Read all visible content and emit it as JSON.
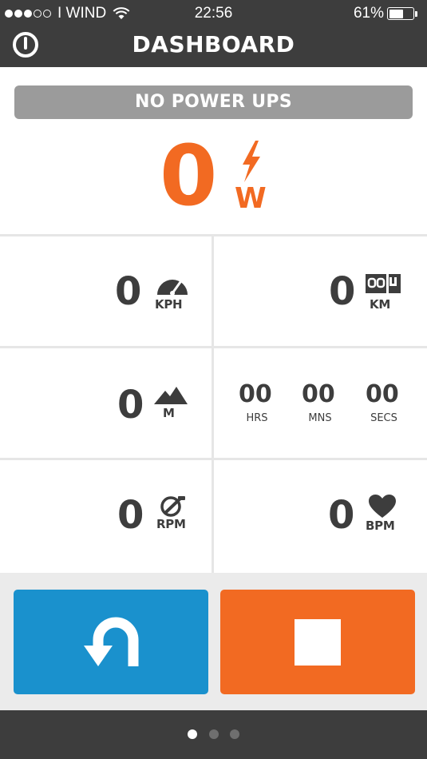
{
  "status_bar": {
    "carrier": "I WIND",
    "time": "22:56",
    "battery": "61%",
    "battery_level": 0.61,
    "signal_bars_filled": 3,
    "signal_bars_total": 5
  },
  "header": {
    "title": "DASHBOARD"
  },
  "powerups": {
    "label": "NO POWER UPS"
  },
  "power": {
    "value": "0",
    "unit": "W"
  },
  "metrics": {
    "speed": {
      "value": "0",
      "unit": "KPH",
      "icon": "speedometer-icon"
    },
    "distance": {
      "value": "0",
      "unit": "KM",
      "icon": "odometer-icon"
    },
    "elevation": {
      "value": "0",
      "unit": "M",
      "icon": "mountain-icon"
    },
    "cadence": {
      "value": "0",
      "unit": "RPM",
      "icon": "crank-icon"
    },
    "heart_rate": {
      "value": "0",
      "unit": "BPM",
      "icon": "heart-icon"
    }
  },
  "elapsed": {
    "hours": "00",
    "hours_label": "HRS",
    "minutes": "00",
    "minutes_label": "MNS",
    "seconds": "00",
    "seconds_label": "SECS"
  },
  "page_indicator": {
    "count": 3,
    "active": 0
  },
  "colors": {
    "accent_orange": "#f26a22",
    "accent_blue": "#1a91cd",
    "bar_dark": "#3d3d3d",
    "pill_gray": "#9b9b9b"
  }
}
